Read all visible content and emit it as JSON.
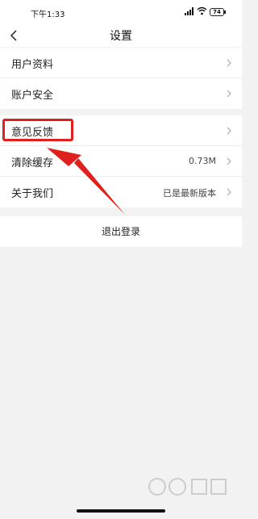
{
  "status_bar": {
    "time": "下午1:33",
    "signal_icon": "signal-icon",
    "wifi_icon": "wifi-icon",
    "battery": "74"
  },
  "nav": {
    "title": "设置",
    "back_icon": "back-chevron-icon"
  },
  "group1": [
    {
      "label": "用户资料"
    },
    {
      "label": "账户安全"
    }
  ],
  "group2": [
    {
      "label": "意见反馈",
      "value": ""
    },
    {
      "label": "清除缓存",
      "value": "0.73M"
    },
    {
      "label": "关于我们",
      "value": "已是最新版本"
    }
  ],
  "logout": {
    "label": "退出登录"
  },
  "annotation": {
    "color": "#e0201c"
  },
  "watermark": {
    "icon": "baidu-jingyan-watermark"
  }
}
